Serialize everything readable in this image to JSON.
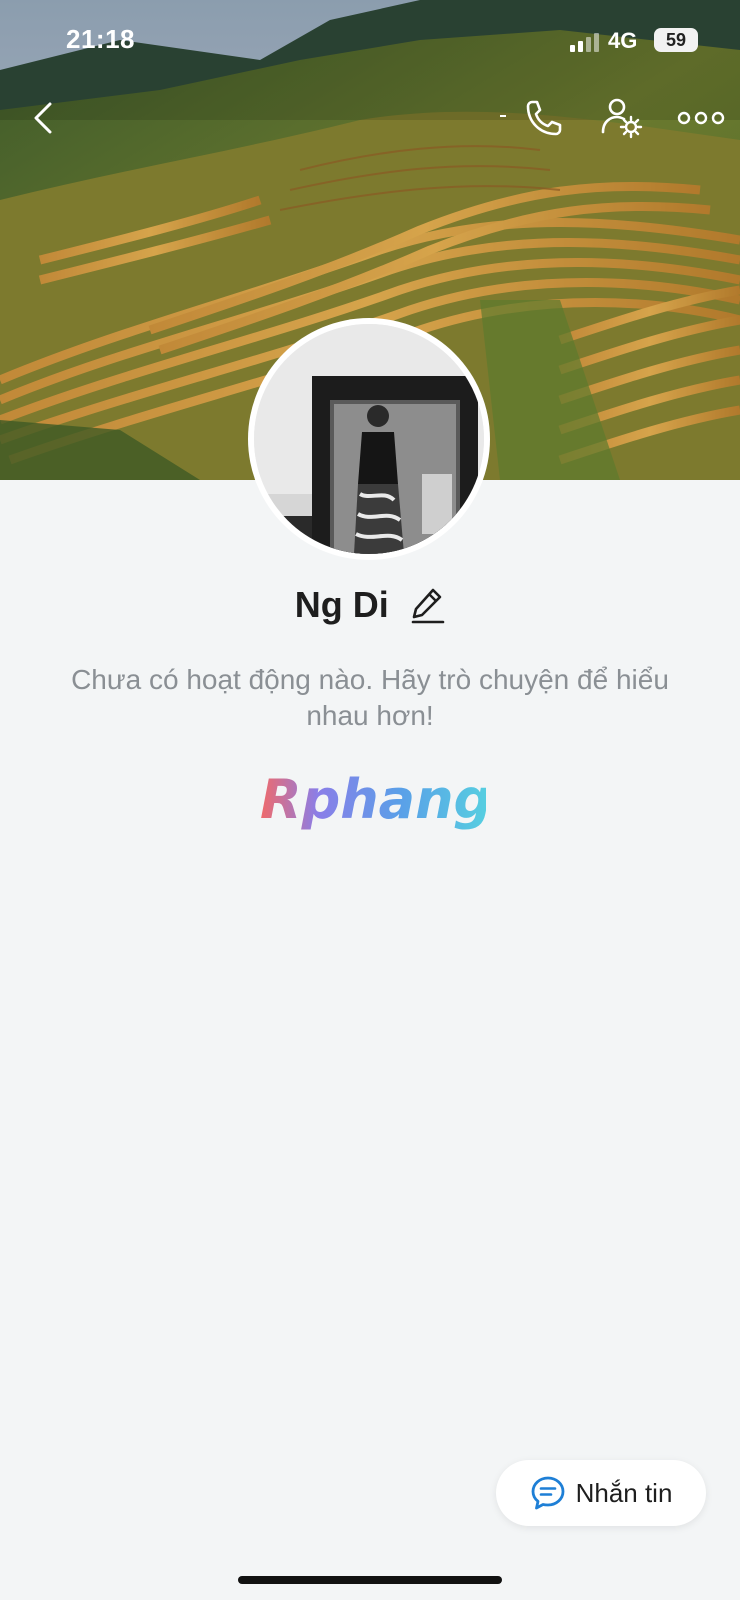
{
  "status_bar": {
    "time": "21:18",
    "network": "4G",
    "battery": "59"
  },
  "nav": {
    "back_icon": "chevron-left-icon",
    "call_icon": "phone-icon",
    "settings_icon": "user-settings-icon",
    "more_icon": "more-horizontal-icon"
  },
  "profile": {
    "name": "Ng Di",
    "edit_icon": "pencil-icon",
    "empty_message": "Chưa có hoạt động nào. Hãy trò chuyện để hiểu nhau hơn!"
  },
  "watermark": {
    "text": "Rphang"
  },
  "actions": {
    "message_label": "Nhắn tin",
    "message_icon": "chat-bubble-icon"
  },
  "colors": {
    "background": "#f3f5f6",
    "accent_blue": "#1e7fd6"
  }
}
